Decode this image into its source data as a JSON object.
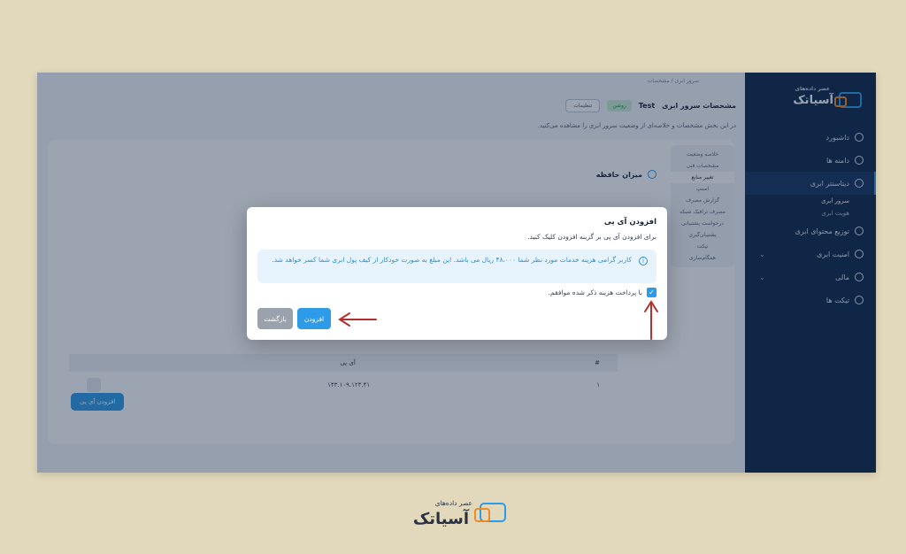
{
  "sidebar": {
    "logo_small": "عصر داده‌های",
    "logo_text": "آسیاتک",
    "items": [
      {
        "label": "داشبورد"
      },
      {
        "label": "دامنه ها"
      },
      {
        "label": "دیتاسنتر ابری"
      },
      {
        "label": "توزیع محتوای ابری"
      },
      {
        "label": "امنیت ابری"
      },
      {
        "label": "مالی"
      },
      {
        "label": "تیکت ها"
      }
    ],
    "sub_items": [
      {
        "label": "سرور ابری"
      },
      {
        "label": "هویت ابری"
      }
    ]
  },
  "main": {
    "breadcrumb": "سرور ابری / مشخصات",
    "title": "مشخصات سرور ابری",
    "server_name": "Test",
    "status_badge": "روشن",
    "settings_label": "تنظیمات",
    "subtitle": "در این بخش مشخصات و خلاصه‌ای از وضعیت سرور ابری را مشاهده می‌کنید.",
    "tabs": [
      "خلاصه وضعیت",
      "مشخصات فنی",
      "تغییر منابع",
      "اسنپ",
      "گزارش مصرف",
      "مصرف ترافیک شبکه",
      "درخواست پشتیبانی",
      "پشتیبان‌گیری",
      "تیکت",
      "همگام‌سازی"
    ],
    "section_title": "میزان حافظه",
    "add_ip_button": "افزودن آی پی",
    "table": {
      "headers": [
        "#",
        "آی پی"
      ],
      "rows": [
        {
          "index": "۱",
          "ip": "۱۴۳.۱۰۹.۱۲۳.۴۱"
        }
      ]
    }
  },
  "modal": {
    "title": "افزودن آی پی",
    "description": "برای افزودن آی پی بر گزینه افزودن کلیک کنید.",
    "alert_text": "کاربر گرامی هزینه خدمات مورد نظر شما ۴۸،۰۰۰ ریال می باشد. این مبلغ به صورت خودکار از کیف پول ابری شما کسر خواهد شد.",
    "agree_label": "با پرداخت هزینه ذکر شده موافقم.",
    "add_button": "افزودن",
    "back_button": "بازگشت"
  },
  "brand": {
    "small_text": "عصر داده‌های",
    "name": "آسیاتک"
  },
  "colors": {
    "accent": "#2d9be8",
    "sidebar": "#0f2748",
    "arrow": "#b5302c",
    "background": "#e2d9bc"
  }
}
